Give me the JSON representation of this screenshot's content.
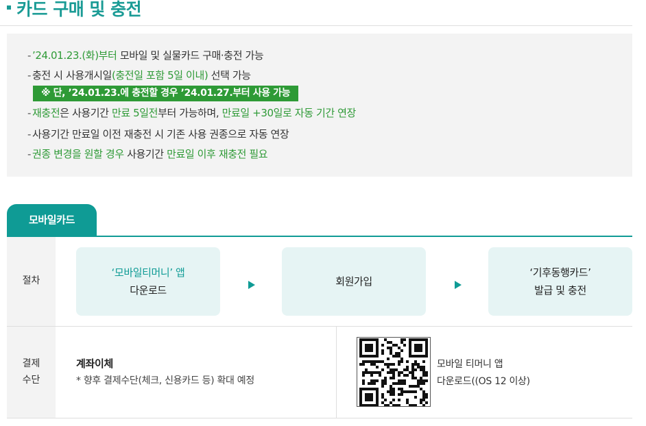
{
  "page_title": "카드 구매 및 충전",
  "notices": [
    {
      "parts": [
        {
          "t": "’24.01.23.(화)부터",
          "g": true
        },
        {
          "t": " 모바일 및 실물카드 구매·충전 가능",
          "g": false
        }
      ]
    },
    {
      "parts": [
        {
          "t": "충전 시 사용개시일",
          "g": false
        },
        {
          "t": "(충전일 포함 5일 이내)",
          "g": true
        },
        {
          "t": " 선택 가능",
          "g": false
        }
      ]
    },
    {
      "parts": [
        {
          "t": "재충전",
          "g": true
        },
        {
          "t": "은 사용기간 ",
          "g": false
        },
        {
          "t": "만료 5일전",
          "g": true
        },
        {
          "t": "부터 가능하며, ",
          "g": false
        },
        {
          "t": "만료일 +30일로 자동 기간 연장",
          "g": true
        }
      ]
    },
    {
      "parts": [
        {
          "t": "사용기간 만료일 이전 재충전 시 기존 사용 권종으로 자동 연장",
          "g": false
        }
      ]
    },
    {
      "parts": [
        {
          "t": "권종 변경을 원할 경우",
          "g": true
        },
        {
          "t": " 사용기간 ",
          "g": false
        },
        {
          "t": "만료일 이후 재충전 필요",
          "g": true
        }
      ]
    }
  ],
  "notice_box": "※ 단, ’24.01.23.에 충전할 경우 ’24.01.27.부터 사용 가능",
  "tab_label": "모바일카드",
  "procedure": {
    "label": "절차",
    "steps": [
      {
        "line1": "‘모바일티머니’ 앱",
        "line2": "다운로드"
      },
      {
        "line1": "회원가입",
        "line2": ""
      },
      {
        "line1": "‘기후동행카드’",
        "line2": "발급 및 충전"
      }
    ]
  },
  "payment": {
    "label_line1": "결제",
    "label_line2": "수단",
    "method": "계좌이체",
    "note": "* 향후 결제수단(체크, 신용카드 등) 확대 예정",
    "app_line1": "모바일 티머니 앱",
    "app_line2": "다운로드((OS 12 이상)"
  },
  "colors": {
    "accent": "#0f9b95",
    "highlight_green": "#2e9a36",
    "panel_gray": "#f3f3f3",
    "step_bg": "#e6f4f4"
  },
  "icons": {
    "title_bullet": "square-bullet-icon",
    "arrow": "triangle-right-icon",
    "qr": "qr-code-icon"
  }
}
